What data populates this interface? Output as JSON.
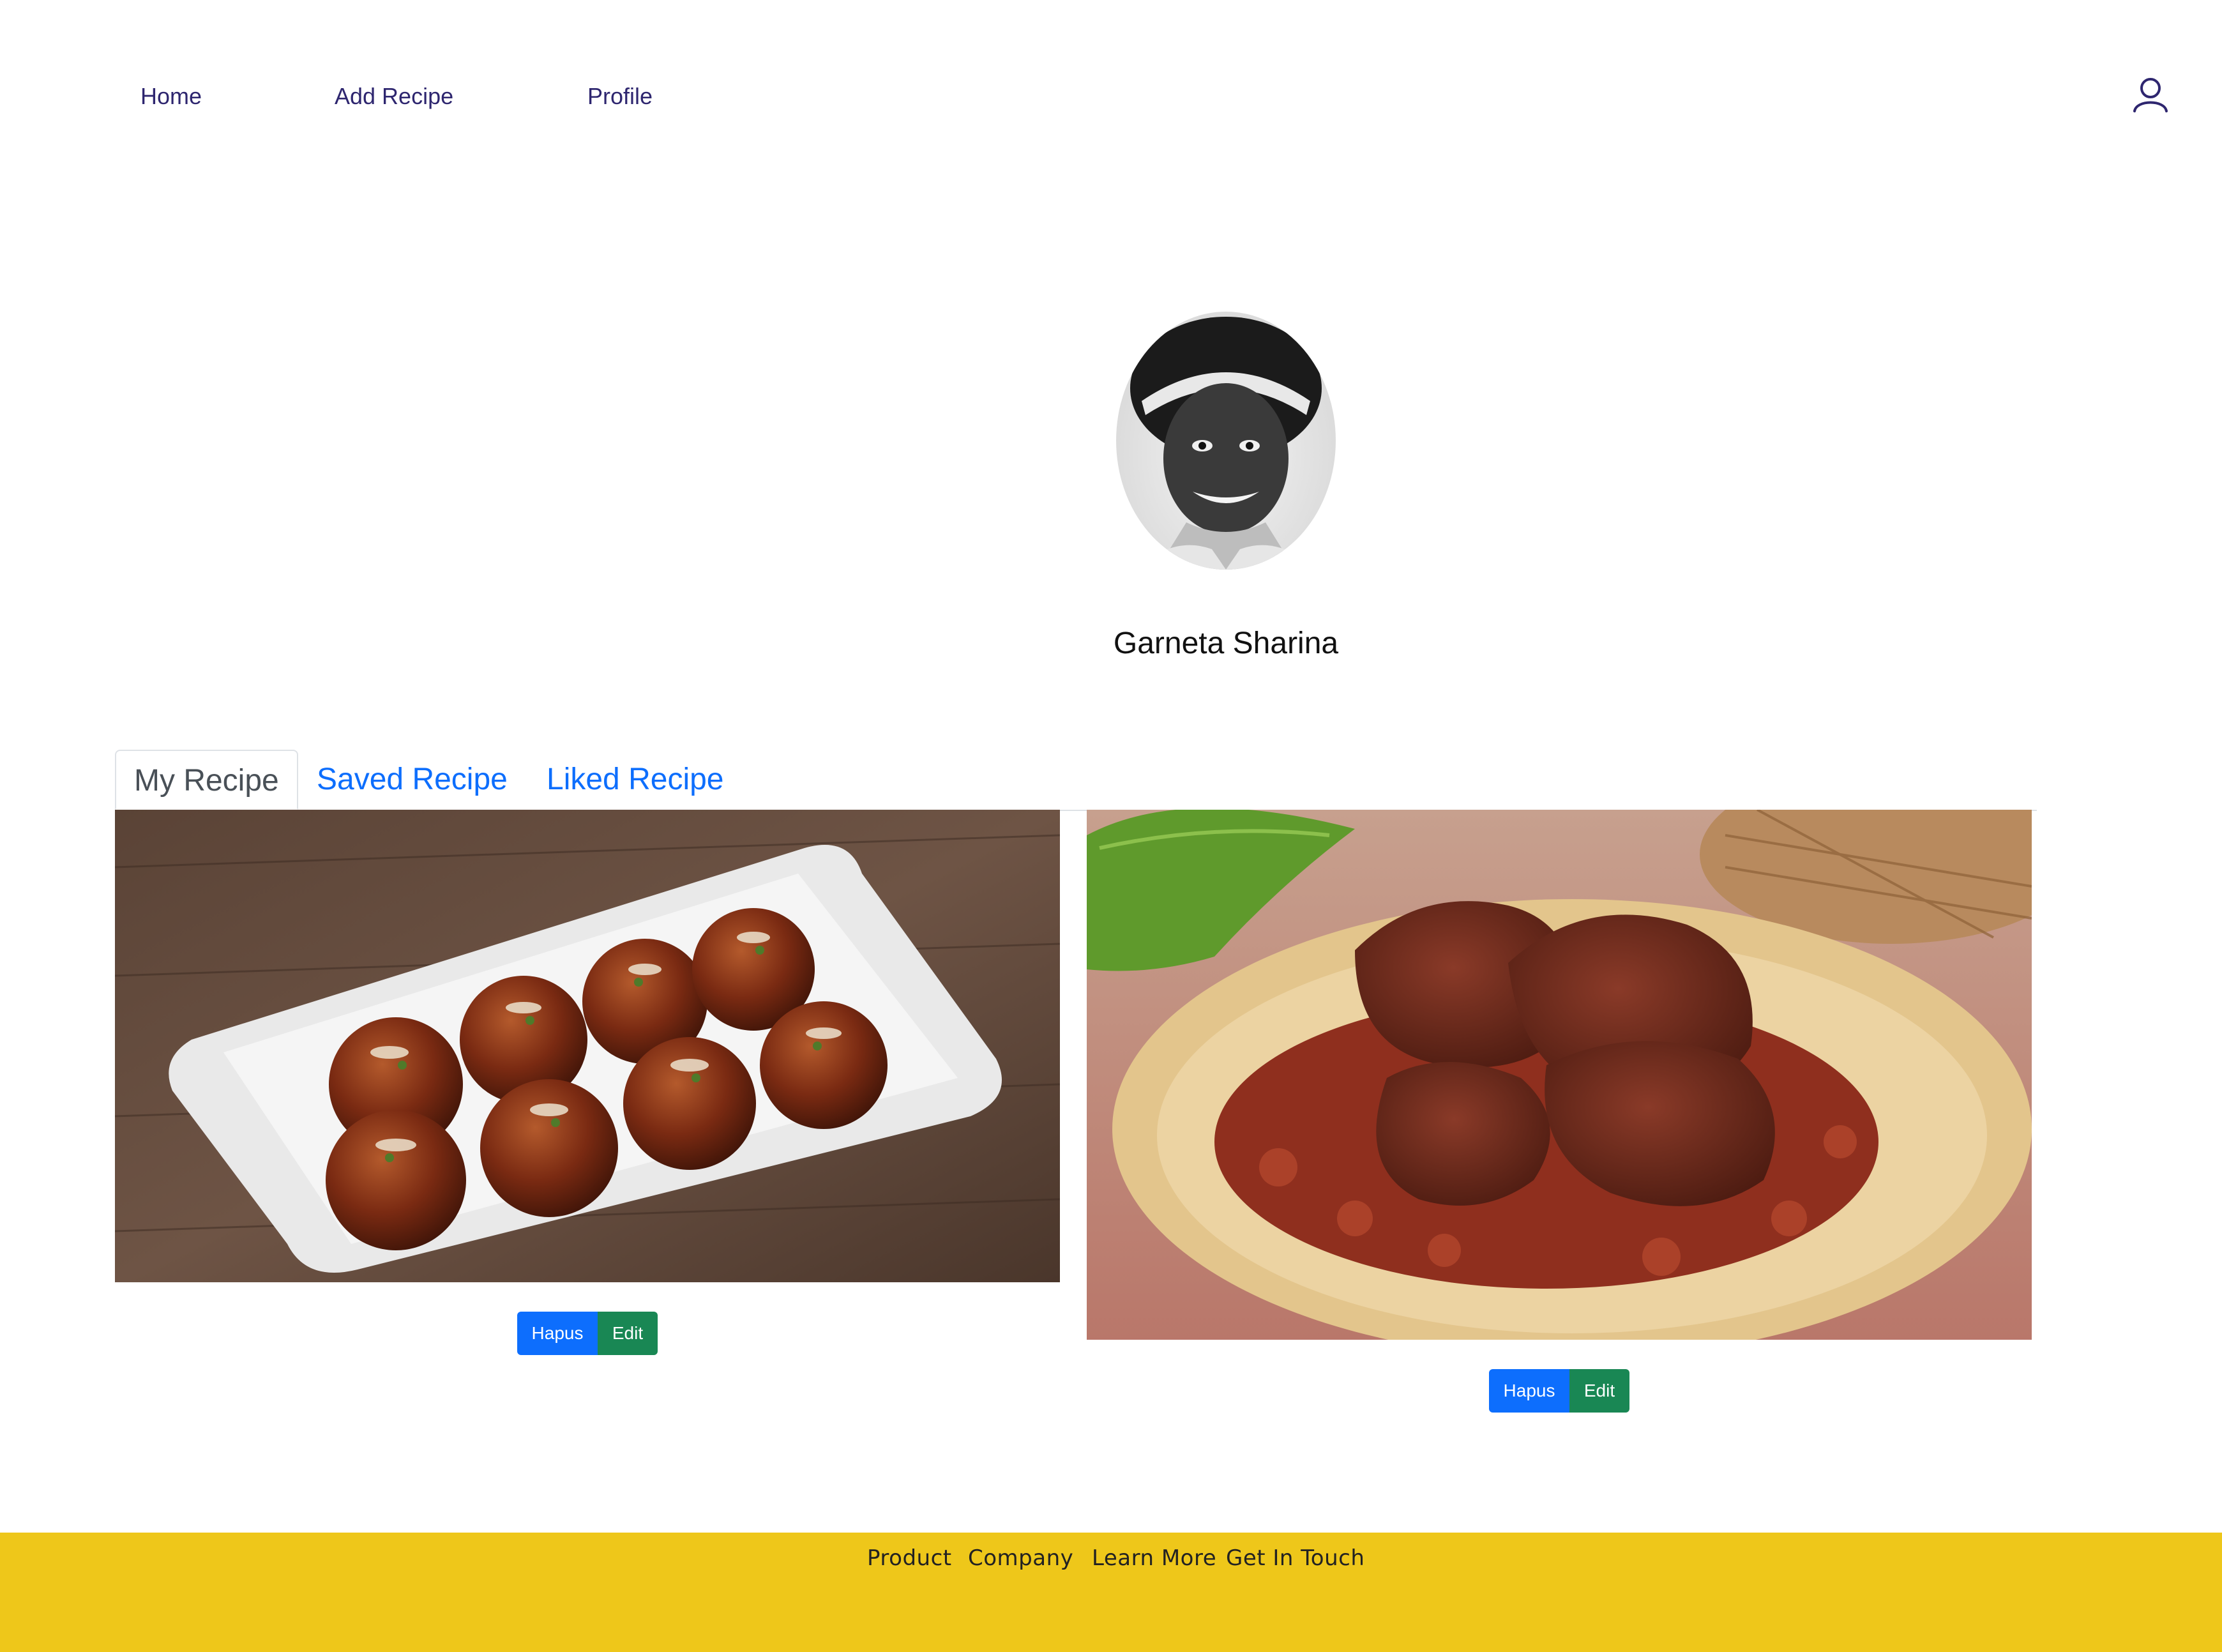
{
  "nav": {
    "items": [
      {
        "label": "Home"
      },
      {
        "label": "Add Recipe"
      },
      {
        "label": "Profile"
      }
    ],
    "user_icon": "user-icon"
  },
  "profile": {
    "name": "Garneta Sharina",
    "avatar_icon": "profile-photo"
  },
  "tabs": [
    {
      "label": "My Recipe",
      "active": true
    },
    {
      "label": "Saved Recipe",
      "active": false
    },
    {
      "label": "Liked Recipe",
      "active": false
    }
  ],
  "recipes": [
    {
      "image": "takoyaki-photo",
      "delete_label": "Hapus",
      "edit_label": "Edit"
    },
    {
      "image": "rendang-photo",
      "delete_label": "Hapus",
      "edit_label": "Edit"
    }
  ],
  "footer": {
    "links": [
      "Product",
      "Company",
      "Learn More",
      "Get In Touch"
    ]
  },
  "colors": {
    "nav_text": "#2e266f",
    "tab_link": "#0d6efd",
    "delete_button": "#0d6efd",
    "edit_button": "#198754",
    "footer_bg": "#eec71a"
  }
}
